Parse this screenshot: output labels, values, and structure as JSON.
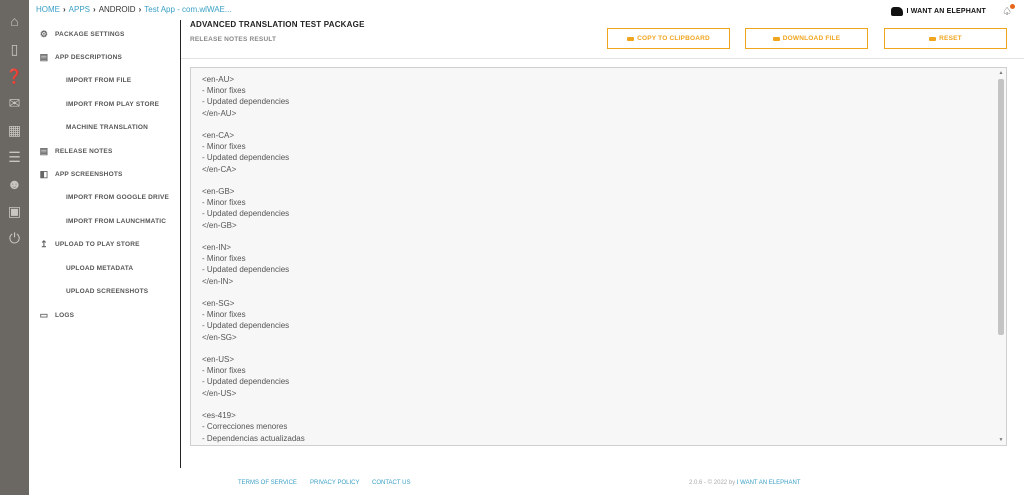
{
  "rail": {
    "icons": [
      "home-icon",
      "phone-icon",
      "help-icon",
      "mail-icon",
      "calendar-icon",
      "list-icon",
      "user-icon",
      "cart-icon",
      "power-icon"
    ]
  },
  "breadcrumb": {
    "home": "HOME",
    "apps": "APPS",
    "platform": "ANDROID",
    "app": "Test App - com.wlWAE..."
  },
  "brand": {
    "name": "I WANT AN ELEPHANT"
  },
  "sidebar": {
    "items": [
      {
        "label": "PACKAGE SETTINGS",
        "icon": "gear-icon"
      },
      {
        "label": "APP DESCRIPTIONS",
        "icon": "document-icon"
      },
      {
        "label": "IMPORT FROM FILE"
      },
      {
        "label": "IMPORT FROM PLAY STORE"
      },
      {
        "label": "MACHINE TRANSLATION"
      },
      {
        "label": "RELEASE NOTES",
        "icon": "document-icon"
      },
      {
        "label": "APP SCREENSHOTS",
        "icon": "image-icon"
      },
      {
        "label": "IMPORT FROM GOOGLE DRIVE"
      },
      {
        "label": "IMPORT FROM LAUNCHMATIC"
      },
      {
        "label": "UPLOAD TO PLAY STORE",
        "icon": "upload-icon"
      },
      {
        "label": "UPLOAD METADATA"
      },
      {
        "label": "UPLOAD SCREENSHOTS"
      },
      {
        "label": "LOGS",
        "icon": "logs-icon"
      }
    ]
  },
  "header": {
    "title": "ADVANCED TRANSLATION TEST PACKAGE",
    "subtitle": "RELEASE NOTES RESULT"
  },
  "actions": {
    "copy": "COPY TO CLIPBOARD",
    "download": "DOWNLOAD FILE",
    "reset": "RESET"
  },
  "result": {
    "text": "<en-AU>\n- Minor fixes\n- Updated dependencies\n</en-AU>\n\n<en-CA>\n- Minor fixes\n- Updated dependencies\n</en-CA>\n\n<en-GB>\n- Minor fixes\n- Updated dependencies\n</en-GB>\n\n<en-IN>\n- Minor fixes\n- Updated dependencies\n</en-IN>\n\n<en-SG>\n- Minor fixes\n- Updated dependencies\n</en-SG>\n\n<en-US>\n- Minor fixes\n- Updated dependencies\n</en-US>\n\n<es-419>\n- Correcciones menores\n- Dependencias actualizadas"
  },
  "footer": {
    "terms": "TERMS OF SERVICE",
    "privacy": "PRIVACY POLICY",
    "contact": "CONTACT US",
    "version": "2.0.6 - © 2022 by",
    "company": "I WANT AN ELEPHANT"
  },
  "colors": {
    "accent": "#f0a51e",
    "link": "#3aa0c4",
    "rail": "#6b6762"
  }
}
